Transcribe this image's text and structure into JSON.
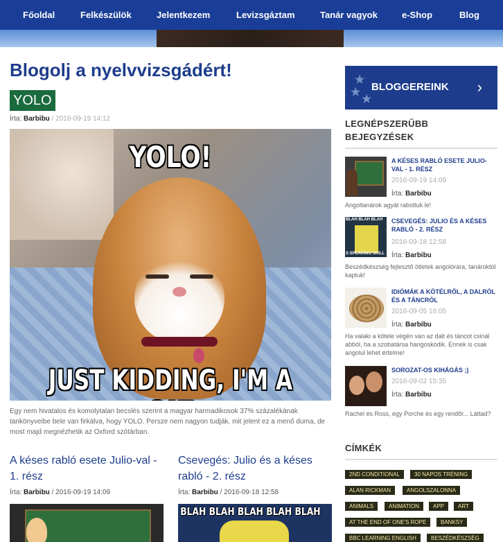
{
  "nav": {
    "items": [
      "Főoldal",
      "Felkészülök",
      "Jelentkezem",
      "Levizsgáztam",
      "Tanár vagyok",
      "e-Shop",
      "Blog"
    ]
  },
  "main": {
    "page_title": "Blogolj a nyelvvizsgádért!",
    "post": {
      "tag": "YOLO",
      "byline_prefix": "Írta:",
      "author": "Barbibu",
      "separator": "/",
      "date": "2016-09-19 14:12",
      "meme_top": "YOLO!",
      "meme_bottom": "JUST KIDDING, I'M A CAT",
      "excerpt": "Egy nem hivatalos és komolytalan becslés szerint a magyar harmadikosok 37% százalékának tankönyveibe bele van firkálva, hogy YOLO. Persze nem nagyon tudják, mit jelent ez a menő duma, de most majd megnézhetik az Oxford szótárban."
    },
    "cards": [
      {
        "title": "A késes rabló esete Julio-val - 1. rész",
        "byline_prefix": "Írta:",
        "author": "Barbibu",
        "separator": "/",
        "date": "2016-09-19 14:09"
      },
      {
        "title": "Csevegés: Julio és a késes rabló - 2. rész",
        "byline_prefix": "Írta:",
        "author": "Barbibu",
        "separator": "/",
        "date": "2016-09-18 12:58",
        "thumb_text": "BLAH BLAH BLAH BLAH BLAH"
      }
    ]
  },
  "sidebar": {
    "bloggers_button": "BLOGGEREINK",
    "popular_heading": "LEGNÉPSZERŰBB BEJEGYZÉSEK",
    "popular": [
      {
        "title": "A KÉSES RABLÓ ESETE JULIO-VAL - 1. RÉSZ",
        "date": "2016-09-19 14:09",
        "byline_prefix": "Írta:",
        "author": "Barbibu",
        "excerpt": "Angoltanárok agyát raboltuk le!"
      },
      {
        "title": "CSEVEGÉS: JULIO ÉS A KÉSES RABLÓ - 2. RÉSZ",
        "date": "2016-09-18 12:58",
        "byline_prefix": "Írta:",
        "author": "Barbibu",
        "excerpt": "Beszédkészség fejlesztő ötletek angolórára, tanároktól kaptuk!",
        "thumb_top": "BLAH BLAH BLAH",
        "thumb_bottom": "S SPEAKING SKILL"
      },
      {
        "title": "IDIÓMÁK A KÖTÉLRŐL, A DALRÓL ÉS A TÁNCRÓL",
        "date": "2016-09-05 16:05",
        "byline_prefix": "Írta:",
        "author": "Barbibu",
        "excerpt": "Ha valaki a kötele végén van az dalt és táncot csinál abból, ha a szobatársa hangoskodik. Ennek is csak angolul lehet értelme!"
      },
      {
        "title": "SOROZAT-OS KIHÁGÁS ;)",
        "date": "2016-09-02 15:35",
        "byline_prefix": "Írta:",
        "author": "Barbibu",
        "excerpt": "Rachel és Ross, egy Porche és egy rendőr... Láttad?"
      }
    ],
    "tags_heading": "CÍMKÉK",
    "tags": [
      "2ND CONDITIONAL",
      "30 NAPOS TRÉNING",
      "ALAN RICKMAN",
      "ANGOLSZALONNA",
      "ANIMALS",
      "ANIMATION",
      "APP",
      "ART",
      "AT THE END OF ONE'S ROPE",
      "BANKSY",
      "BBC LEARNING ENGLISH",
      "BESZÉDKÉSZSÉG"
    ]
  }
}
